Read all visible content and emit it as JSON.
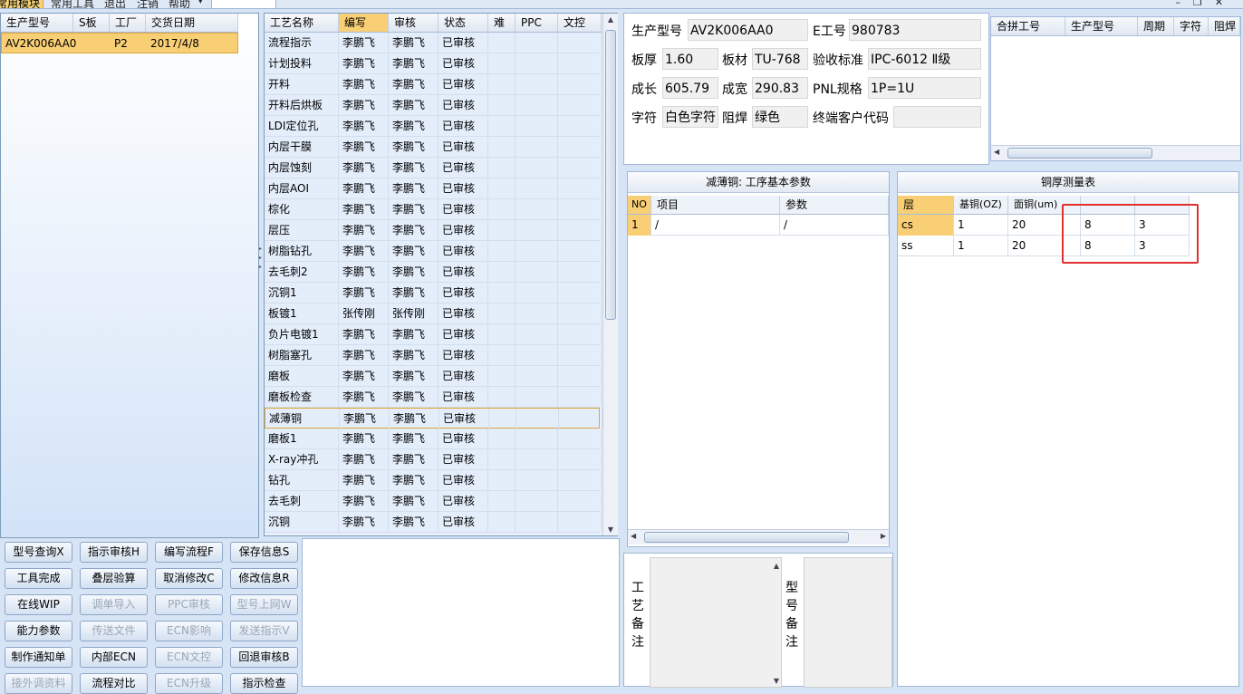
{
  "menubar": {
    "items": [
      "常用模块",
      "常用工具",
      "退出",
      "注销",
      "帮助"
    ],
    "selected_index": 0
  },
  "left_grid": {
    "columns": [
      "生产型号",
      "S板",
      "工厂",
      "交货日期"
    ],
    "rows": [
      {
        "model": "AV2K006AA0",
        "s_board": "",
        "factory": "P2",
        "date": "2017/4/8"
      }
    ]
  },
  "process_grid": {
    "columns": [
      "工艺名称",
      "编写",
      "审核",
      "状态",
      "难",
      "PPC",
      "文控"
    ],
    "selected_column": 1,
    "selected_row": 18,
    "rows": [
      [
        "流程指示",
        "李鹏飞",
        "李鹏飞",
        "已审核"
      ],
      [
        "计划投料",
        "李鹏飞",
        "李鹏飞",
        "已审核"
      ],
      [
        "开料",
        "李鹏飞",
        "李鹏飞",
        "已审核"
      ],
      [
        "开料后烘板",
        "李鹏飞",
        "李鹏飞",
        "已审核"
      ],
      [
        "LDI定位孔",
        "李鹏飞",
        "李鹏飞",
        "已审核"
      ],
      [
        "内层干膜",
        "李鹏飞",
        "李鹏飞",
        "已审核"
      ],
      [
        "内层蚀刻",
        "李鹏飞",
        "李鹏飞",
        "已审核"
      ],
      [
        "内层AOI",
        "李鹏飞",
        "李鹏飞",
        "已审核"
      ],
      [
        "棕化",
        "李鹏飞",
        "李鹏飞",
        "已审核"
      ],
      [
        "层压",
        "李鹏飞",
        "李鹏飞",
        "已审核"
      ],
      [
        "树脂钻孔",
        "李鹏飞",
        "李鹏飞",
        "已审核"
      ],
      [
        "去毛刺2",
        "李鹏飞",
        "李鹏飞",
        "已审核"
      ],
      [
        "沉铜1",
        "李鹏飞",
        "李鹏飞",
        "已审核"
      ],
      [
        "板镀1",
        "张传刚",
        "张传刚",
        "已审核"
      ],
      [
        "负片电镀1",
        "李鹏飞",
        "李鹏飞",
        "已审核"
      ],
      [
        "树脂塞孔",
        "李鹏飞",
        "李鹏飞",
        "已审核"
      ],
      [
        "磨板",
        "李鹏飞",
        "李鹏飞",
        "已审核"
      ],
      [
        "磨板检查",
        "李鹏飞",
        "李鹏飞",
        "已审核"
      ],
      [
        "减薄铜",
        "李鹏飞",
        "李鹏飞",
        "已审核"
      ],
      [
        "磨板1",
        "李鹏飞",
        "李鹏飞",
        "已审核"
      ],
      [
        "X-ray冲孔",
        "李鹏飞",
        "李鹏飞",
        "已审核"
      ],
      [
        "钻孔",
        "李鹏飞",
        "李鹏飞",
        "已审核"
      ],
      [
        "去毛刺",
        "李鹏飞",
        "李鹏飞",
        "已审核"
      ],
      [
        "沉铜",
        "李鹏飞",
        "李鹏飞",
        "已审核"
      ]
    ]
  },
  "buttons": [
    {
      "label": "型号查询X",
      "enabled": true
    },
    {
      "label": "指示审核H",
      "enabled": true
    },
    {
      "label": "编写流程F",
      "enabled": true
    },
    {
      "label": "保存信息S",
      "enabled": true
    },
    {
      "label": "工具完成",
      "enabled": true
    },
    {
      "label": "叠层验算",
      "enabled": true
    },
    {
      "label": "取消修改C",
      "enabled": true
    },
    {
      "label": "修改信息R",
      "enabled": true
    },
    {
      "label": "在线WIP",
      "enabled": true
    },
    {
      "label": "调单导入",
      "enabled": false
    },
    {
      "label": "PPC审核",
      "enabled": false
    },
    {
      "label": "型号上网W",
      "enabled": false
    },
    {
      "label": "能力参数",
      "enabled": true
    },
    {
      "label": "传送文件",
      "enabled": false
    },
    {
      "label": "ECN影响",
      "enabled": false
    },
    {
      "label": "发送指示V",
      "enabled": false
    },
    {
      "label": "制作通知单",
      "enabled": true
    },
    {
      "label": "内部ECN",
      "enabled": true
    },
    {
      "label": "ECN文控",
      "enabled": false
    },
    {
      "label": "回退审核B",
      "enabled": true
    },
    {
      "label": "接外调资料",
      "enabled": false
    },
    {
      "label": "流程对比",
      "enabled": true
    },
    {
      "label": "ECN升级",
      "enabled": false
    },
    {
      "label": "指示检查",
      "enabled": true
    }
  ],
  "info": {
    "model_label": "生产型号",
    "model": "AV2K006AA0",
    "e_no_label": "E工号",
    "e_no": "980783",
    "thickness_label": "板厚",
    "thickness": "1.60",
    "material_label": "板材",
    "material": "TU-768",
    "standard_label": "验收标准",
    "standard": "IPC-6012 Ⅱ级",
    "length_label": "成长",
    "length": "605.79",
    "width_label": "成宽",
    "width": "290.83",
    "pnl_label": "PNL规格",
    "pnl": "1P=1U",
    "char_label": "字符",
    "char": "白色字符",
    "mask_label": "阻焊",
    "mask": "绿色",
    "customer_label": "终端客户代码",
    "customer": ""
  },
  "combine_grid": {
    "columns": [
      "合拼工号",
      "生产型号",
      "周期",
      "字符",
      "阻焊"
    ]
  },
  "params_section": {
    "title": "减薄铜: 工序基本参数",
    "columns": [
      "NO",
      "项目",
      "参数"
    ],
    "rows": [
      [
        "1",
        "/",
        "/"
      ]
    ]
  },
  "copper_section": {
    "title": "铜厚测量表",
    "columns": [
      "层",
      "基铜(OZ)",
      "面铜(um)",
      "",
      ""
    ],
    "rows": [
      [
        "cs",
        "1",
        "20",
        "8",
        "3"
      ],
      [
        "ss",
        "1",
        "20",
        "8",
        "3"
      ]
    ]
  },
  "memo_process_label": [
    "工",
    "艺",
    "备",
    "注"
  ],
  "memo_model_label": [
    "型",
    "号",
    "备",
    "注"
  ],
  "colors": {
    "selection": "#f9cf76",
    "highlight_box": "#e03030",
    "panel_bg": "#d6e4f5"
  }
}
